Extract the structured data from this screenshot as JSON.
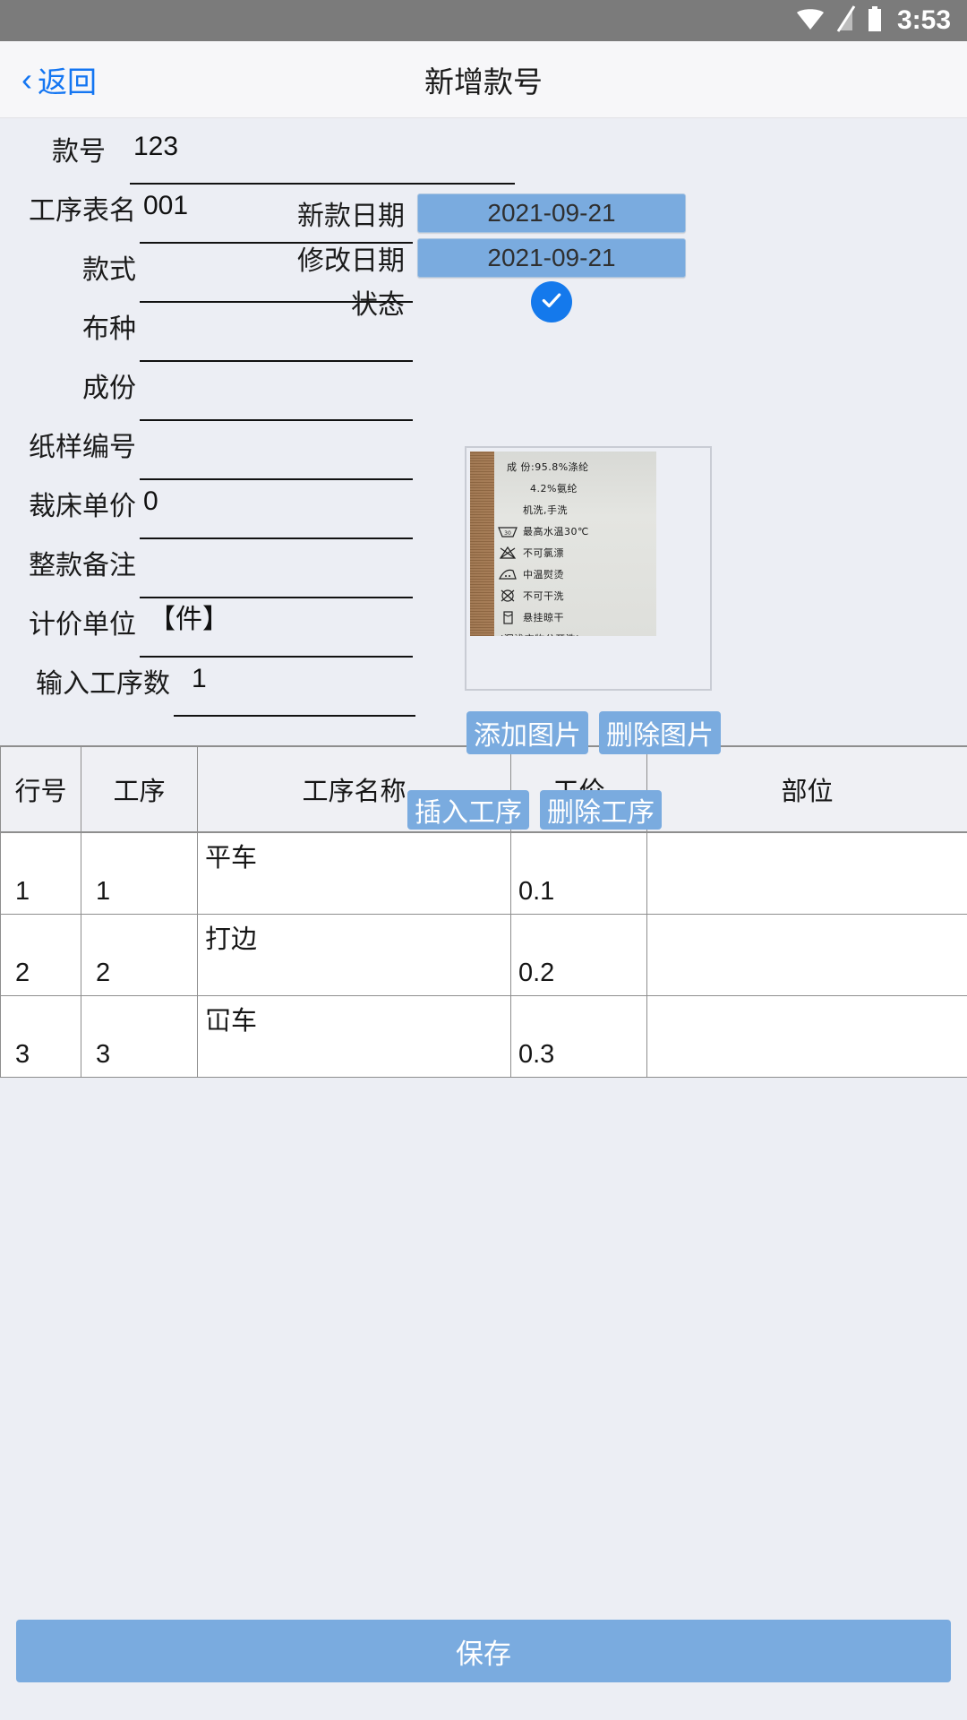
{
  "statusbar": {
    "time": "3:53",
    "icons": [
      "wifi-icon",
      "signal-icon",
      "battery-icon"
    ]
  },
  "appbar": {
    "back_label": "返回",
    "back_icon": "chevron-left-icon",
    "title": "新增款号"
  },
  "form": {
    "left_fields": [
      {
        "label": "款号",
        "value": "123"
      },
      {
        "label": "工序表名",
        "value": "001"
      },
      {
        "label": "款式",
        "value": ""
      },
      {
        "label": "布种",
        "value": ""
      },
      {
        "label": "成份",
        "value": ""
      },
      {
        "label": "纸样编号",
        "value": ""
      },
      {
        "label": "裁床单价",
        "value": "0"
      },
      {
        "label": "整款备注",
        "value": ""
      },
      {
        "label": "计价单位",
        "value": "【件】"
      },
      {
        "label": "输入工序数",
        "value": "1"
      }
    ],
    "right_fields": [
      {
        "label": "新款日期",
        "value": "2021-09-21"
      },
      {
        "label": "修改日期",
        "value": "2021-09-21"
      }
    ],
    "status": {
      "label": "状态",
      "checked_icon": "check-circle-icon",
      "checked": true
    }
  },
  "photo": {
    "alt": "clothing-care-label-photo",
    "label_lines": [
      {
        "icon": "",
        "text": "成 份:95.8%涤纶"
      },
      {
        "icon": "",
        "text": "4.2%氨纶"
      },
      {
        "icon": "",
        "text": "机洗,手洗"
      },
      {
        "icon": "wash-30-icon",
        "text": "最高水温30℃"
      },
      {
        "icon": "no-bleach-icon",
        "text": "不可氯漂"
      },
      {
        "icon": "iron-medium-icon",
        "text": "中温熨烫"
      },
      {
        "icon": "no-dryclean-icon",
        "text": "不可干洗"
      },
      {
        "icon": "hang-dry-icon",
        "text": "悬挂晾干"
      }
    ],
    "label_footer": "(深浅衣物分开洗)"
  },
  "buttons": {
    "add_image": "添加图片",
    "delete_image": "删除图片",
    "insert_process": "插入工序",
    "delete_process": "删除工序",
    "save": "保存"
  },
  "table": {
    "headers": [
      "行号",
      "工序",
      "工序名称",
      "工价",
      "部位"
    ],
    "rows": [
      {
        "index": "1",
        "seq": "1",
        "name": "平车",
        "price": "0.1",
        "part": ""
      },
      {
        "index": "2",
        "seq": "2",
        "name": "打边",
        "price": "0.2",
        "part": ""
      },
      {
        "index": "3",
        "seq": "3",
        "name": "冚车",
        "price": "0.3",
        "part": ""
      }
    ]
  },
  "colors": {
    "accent_blue": "#7aabdf",
    "link_blue": "#1476f2",
    "check_blue": "#1479ec",
    "page_bg": "#eceef4",
    "statusbar_bg": "#7b7b7b"
  }
}
